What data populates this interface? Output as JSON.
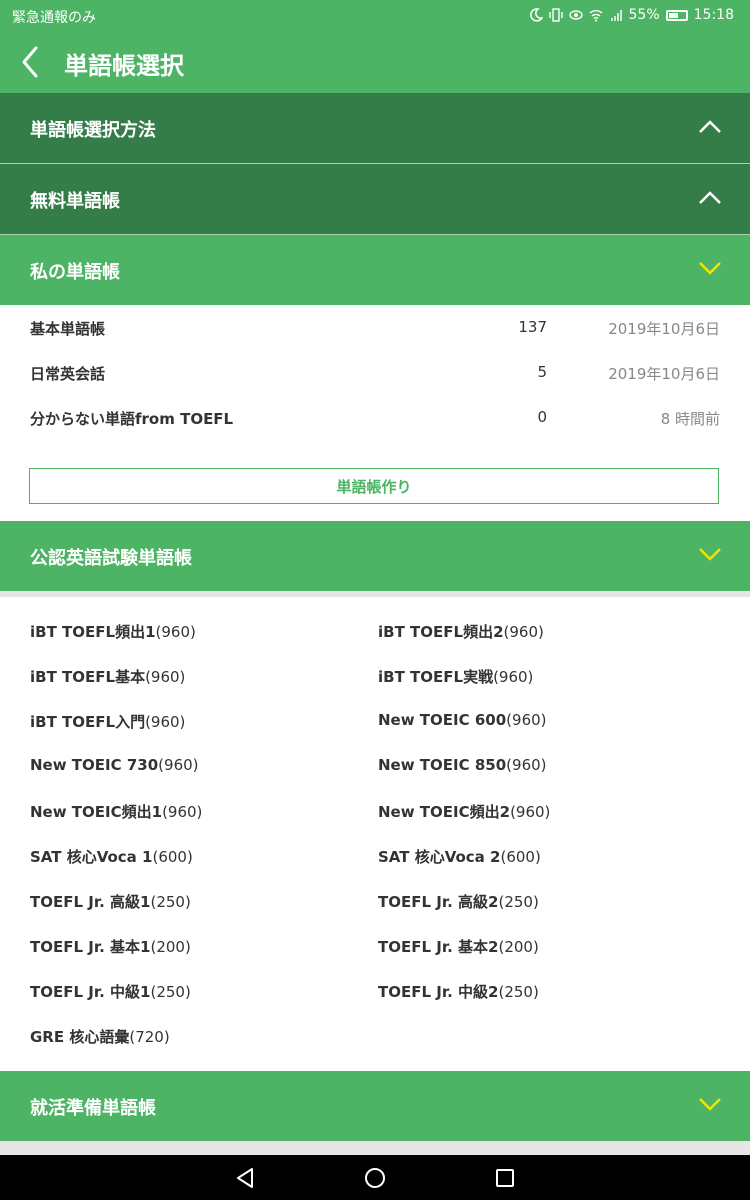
{
  "status_bar": {
    "left_text": "緊急通報のみ",
    "battery": "55%",
    "time": "15:18",
    "icons": [
      "moon-icon",
      "vibrate-icon",
      "eye-icon",
      "wifi-icon",
      "signal-icon",
      "battery-icon"
    ]
  },
  "app_bar": {
    "title": "単語帳選択",
    "back_icon": "chevron-left-icon"
  },
  "sections": {
    "method": {
      "label": "単語帳選択方法",
      "state": "collapsed",
      "icon": "chevron-up-icon"
    },
    "free": {
      "label": "無料単語帳",
      "state": "collapsed",
      "icon": "chevron-up-icon"
    },
    "my": {
      "label": "私の単語帳",
      "state": "expanded",
      "icon": "chevron-down-icon",
      "items": [
        {
          "name": "基本単語帳",
          "count": "137",
          "date": "2019年10月6日"
        },
        {
          "name": "日常英会話",
          "count": "5",
          "date": "2019年10月6日"
        },
        {
          "name": "分からない単語from TOEFL",
          "count": "0",
          "date": "8 時間前"
        }
      ],
      "create_button": "単語帳作り"
    },
    "official": {
      "label": "公認英語試験単語帳",
      "state": "expanded",
      "icon": "chevron-down-icon",
      "books": [
        {
          "name": "iBT TOEFL頻出1",
          "count": "(960)"
        },
        {
          "name": "iBT TOEFL頻出2",
          "count": "(960)"
        },
        {
          "name": "iBT TOEFL基本",
          "count": "(960)"
        },
        {
          "name": "iBT TOEFL実戦",
          "count": "(960)"
        },
        {
          "name": "iBT TOEFL入門",
          "count": "(960)"
        },
        {
          "name": "New TOEIC 600",
          "count": "(960)"
        },
        {
          "name": "New TOEIC 730",
          "count": "(960)"
        },
        {
          "name": "New TOEIC 850",
          "count": "(960)"
        },
        {
          "name": "New TOEIC頻出1",
          "count": "(960)"
        },
        {
          "name": "New TOEIC頻出2",
          "count": "(960)"
        },
        {
          "name": "SAT 核心Voca 1",
          "count": "(600)"
        },
        {
          "name": "SAT 核心Voca 2",
          "count": "(600)"
        },
        {
          "name": "TOEFL Jr. 高級1",
          "count": "(250)"
        },
        {
          "name": "TOEFL Jr. 高級2",
          "count": "(250)"
        },
        {
          "name": "TOEFL Jr. 基本1",
          "count": "(200)"
        },
        {
          "name": "TOEFL Jr. 基本2",
          "count": "(200)"
        },
        {
          "name": "TOEFL Jr. 中級1",
          "count": "(250)"
        },
        {
          "name": "TOEFL Jr. 中級2",
          "count": "(250)"
        },
        {
          "name": "GRE 核心語彙",
          "count": "(720)"
        }
      ]
    },
    "job": {
      "label": "就活準備単語帳",
      "state": "expanded",
      "icon": "chevron-down-icon"
    }
  },
  "nav_bar": {
    "icons": [
      "back-triangle-icon",
      "home-circle-icon",
      "recents-square-icon"
    ]
  },
  "colors": {
    "green": "#4db365",
    "dark_green": "#347d48",
    "yellow_chevron": "#f2e400"
  }
}
